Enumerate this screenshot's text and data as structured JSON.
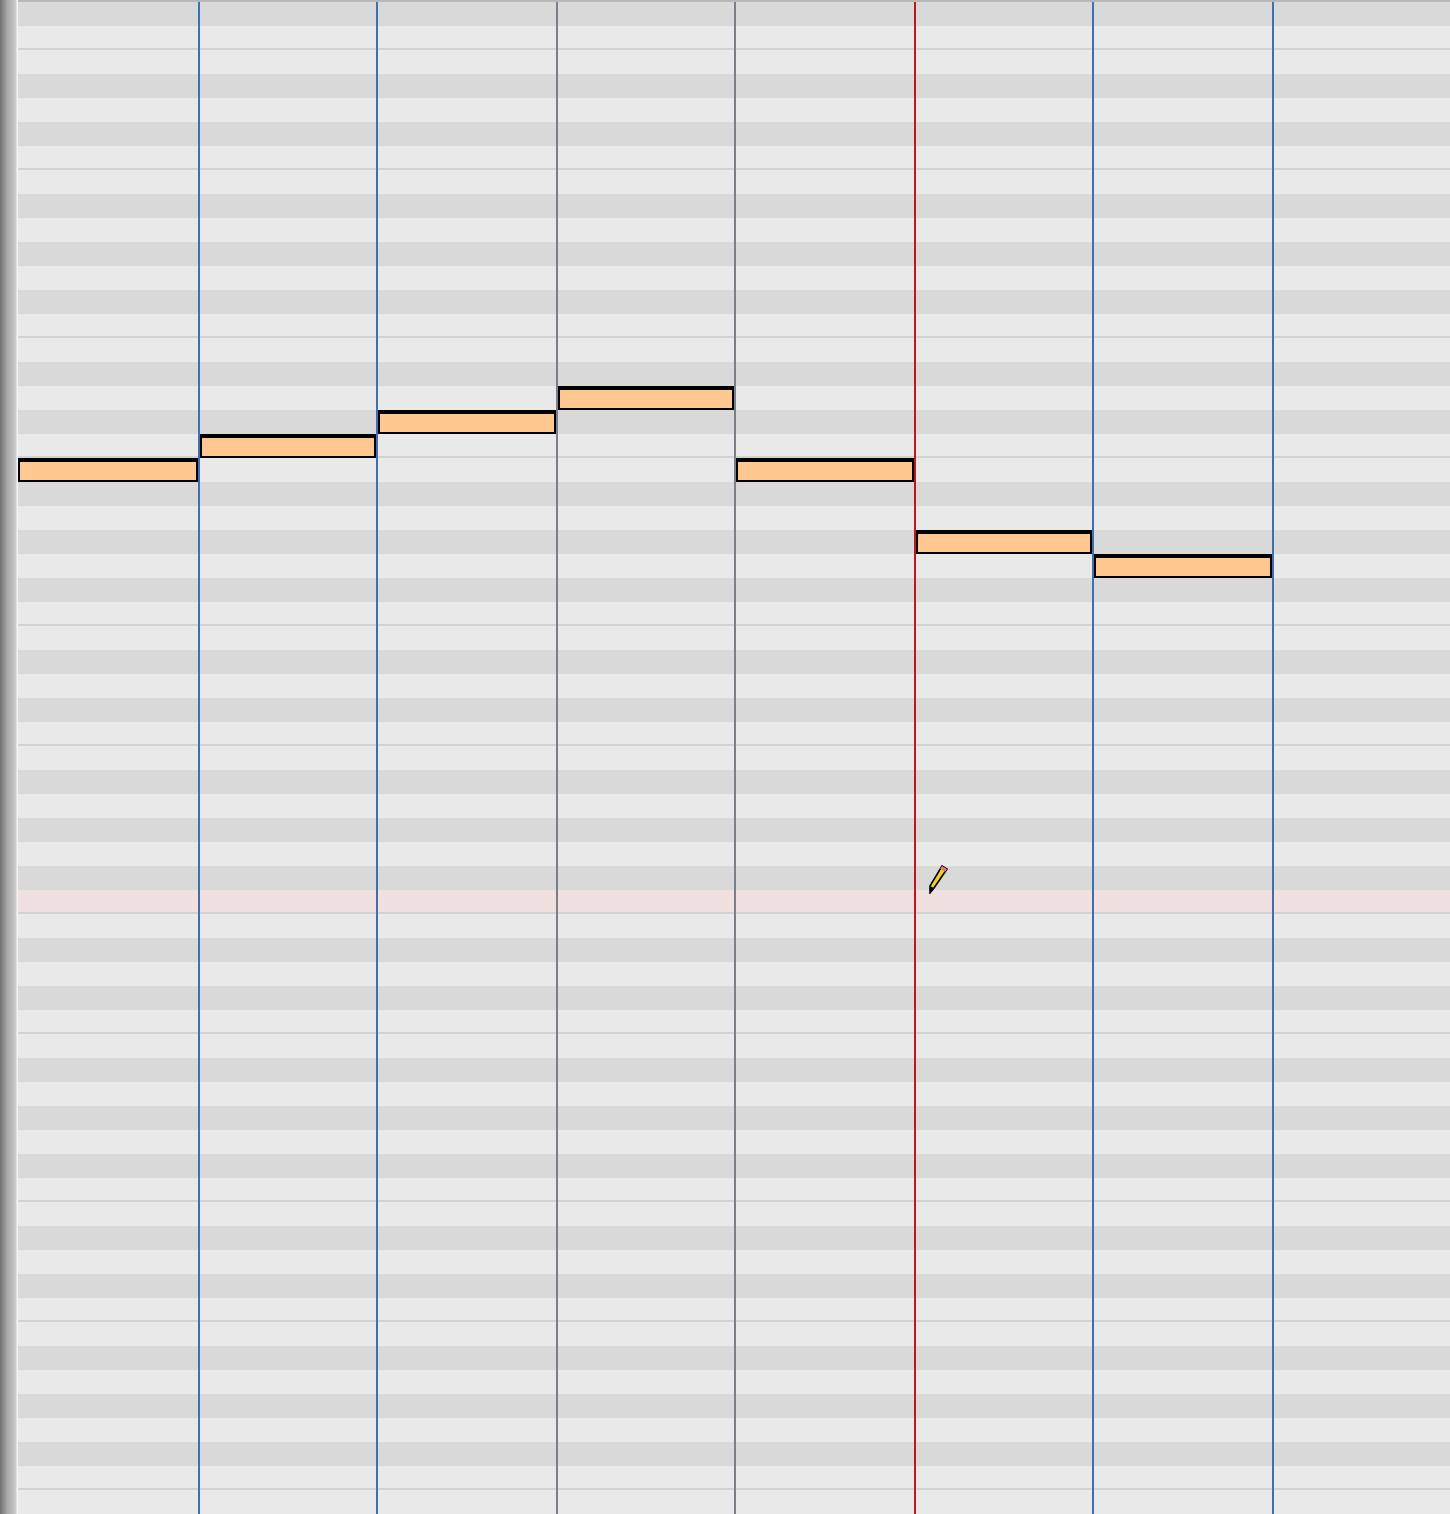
{
  "piano_roll": {
    "grid_lines": [
      {
        "kind": "beat"
      },
      {
        "kind": "beat"
      },
      {
        "kind": "muted"
      },
      {
        "kind": "muted"
      },
      {
        "kind": "playhead"
      },
      {
        "kind": "beat"
      },
      {
        "kind": "beat"
      }
    ],
    "notes": [
      {
        "kind": "note"
      },
      {
        "kind": "note"
      },
      {
        "kind": "note"
      },
      {
        "kind": "note"
      },
      {
        "kind": "note"
      },
      {
        "kind": "note"
      },
      {
        "kind": "note"
      }
    ],
    "cursor": {
      "kind": "pencil"
    }
  }
}
